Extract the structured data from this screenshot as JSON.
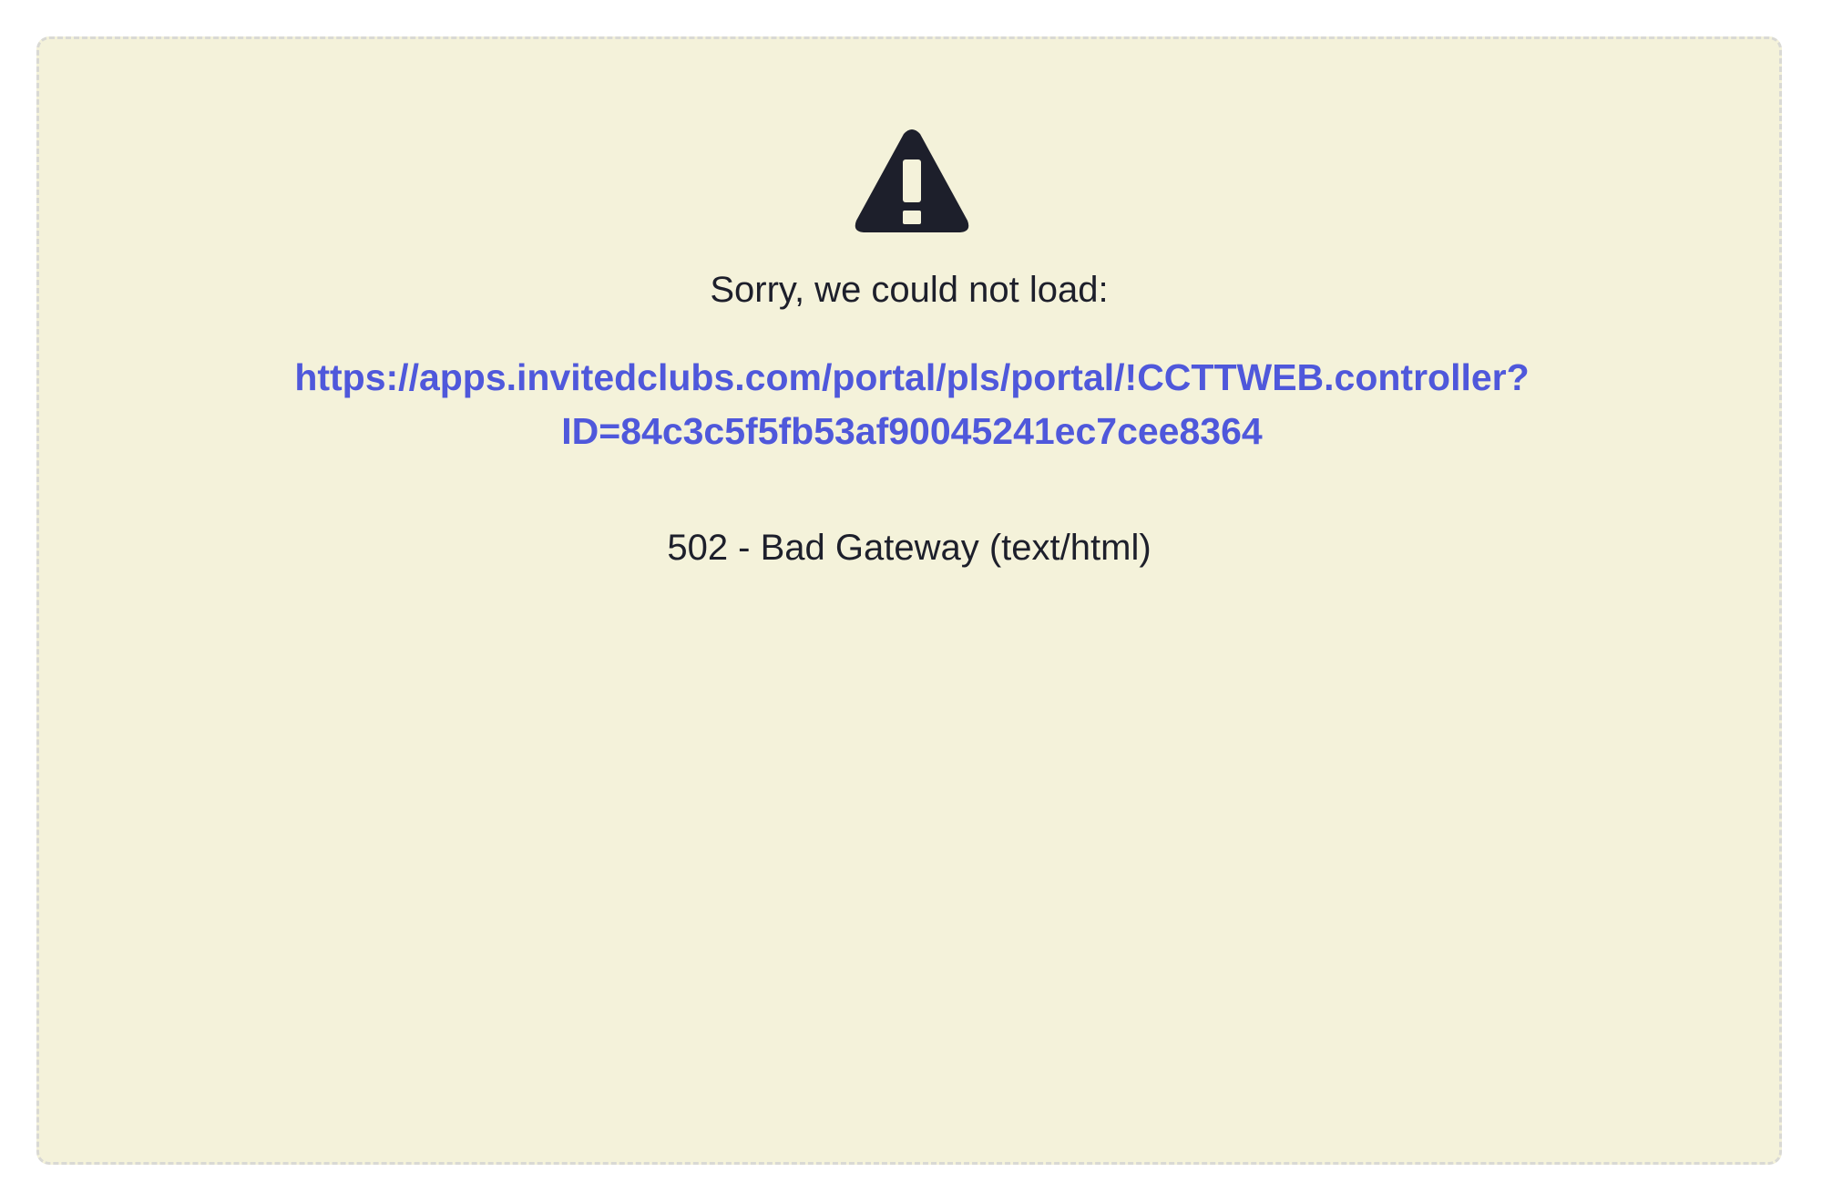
{
  "error": {
    "icon": "warning-triangle-icon",
    "message": "Sorry, we could not load:",
    "url_line_1": "https://apps.invitedclubs.com/portal/pls/portal/!CCTTWEB.controller?",
    "url_line_2": "ID=84c3c5f5fb53af90045241ec7cee8364",
    "status": "502 - Bad Gateway (text/html)"
  },
  "colors": {
    "panel_background": "#f4f2da",
    "panel_border": "#d9d9d4",
    "text": "#1d1f2b",
    "link": "#4f58db"
  }
}
